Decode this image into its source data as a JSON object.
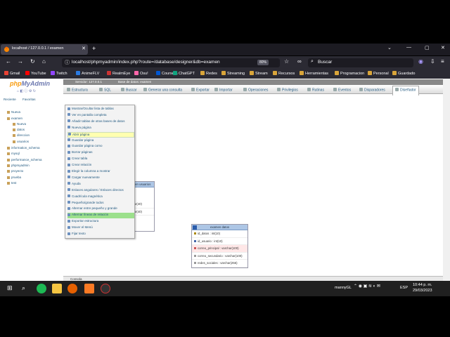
{
  "browser": {
    "tab_title": "localhost / 127.0.0.1 / examen",
    "new_tab": "+",
    "url": "localhost/phpmyadmin/index.php?route=/database/designer&db=examen",
    "zoom": "80%",
    "search_placeholder": "Buscar",
    "window_controls": [
      "⌄",
      "—",
      "▢",
      "✕"
    ]
  },
  "bookmarks": [
    {
      "label": "Gmail",
      "color": "#ea4335"
    },
    {
      "label": "YouTube",
      "color": "#ff0000"
    },
    {
      "label": "Twitch",
      "color": "#9146ff"
    },
    {
      "label": "AnimeFLV",
      "color": "#2a7ae2"
    },
    {
      "label": "RealmEye",
      "color": "#c33"
    },
    {
      "label": "Osu!",
      "color": "#ff66aa"
    },
    {
      "label": "Coursera",
      "color": "#0056d2"
    },
    {
      "label": "ChatGPT",
      "color": "#10a37f"
    },
    {
      "label": "Redes",
      "color": "#d9a53a"
    },
    {
      "label": "Streaming",
      "color": "#d9a53a"
    },
    {
      "label": "Stream",
      "color": "#d9a53a"
    },
    {
      "label": "Recursos",
      "color": "#d9a53a"
    },
    {
      "label": "Herramientas",
      "color": "#d9a53a"
    },
    {
      "label": "Programacion",
      "color": "#d9a53a"
    },
    {
      "label": "Personal",
      "color": "#d9a53a"
    },
    {
      "label": "Guardado",
      "color": "#d9a53a"
    }
  ],
  "pma": {
    "logo_a": "php",
    "logo_b": "MyAdmin",
    "nav_tabs": [
      "Reciente",
      "Favoritas"
    ],
    "tree": [
      "Nueva",
      "examen",
      "Nueva",
      "datos",
      "direccion",
      "usuarios",
      "information_schema",
      "mysql",
      "performance_schema",
      "phpmyadmin",
      "proyecto",
      "prueba",
      "test"
    ],
    "server_bar": [
      "Servidor: 127.0.0.1",
      "Base de datos: examen"
    ],
    "menu_tabs": [
      "Estructura",
      "SQL",
      "Buscar",
      "Generar una consulta",
      "Exportar",
      "Importar",
      "Operaciones",
      "Privilegios",
      "Rutinas",
      "Eventos",
      "Disparadores",
      "Diseñador"
    ],
    "console": "Consola"
  },
  "designer_menu": [
    "Mostrar/Ocultar lista de tablas",
    "Ver en pantalla completa",
    "Añadir tablas de otras bases de datos",
    "Nueva página",
    "Abrir página",
    "Guardar página",
    "Guardar página como",
    "Borrar páginas",
    "Crear tabla",
    "Crear relación",
    "Elegir la columna a mostrar",
    "Cargar nuevamente",
    "Ayuda",
    "Enlaces angulares / Enlaces directos",
    "Cuadrícula magnética",
    "Pequeño/grande todos",
    "Alternar entre pequeño y grande",
    "Alternar líneas de relación",
    "Exportar estructura",
    "Mover el Menú",
    "Fijar texto"
  ],
  "tables": {
    "usuarios": {
      "title": "examen usuarios",
      "rows": [
        "varchar(40)",
        "varchar(40)"
      ]
    },
    "datos": {
      "title": "examen datos",
      "rows": [
        "id_datos : int(10)",
        "id_usuario : int(10)",
        "correo_principal : varchar(100)",
        "correo_secundario : varchar(100)",
        "redes_sociales : varchar(255)"
      ]
    }
  },
  "taskbar": {
    "user": "mannyGL",
    "lang": "ESP",
    "time": "10:44 p. m.",
    "date": "29/03/2023"
  }
}
